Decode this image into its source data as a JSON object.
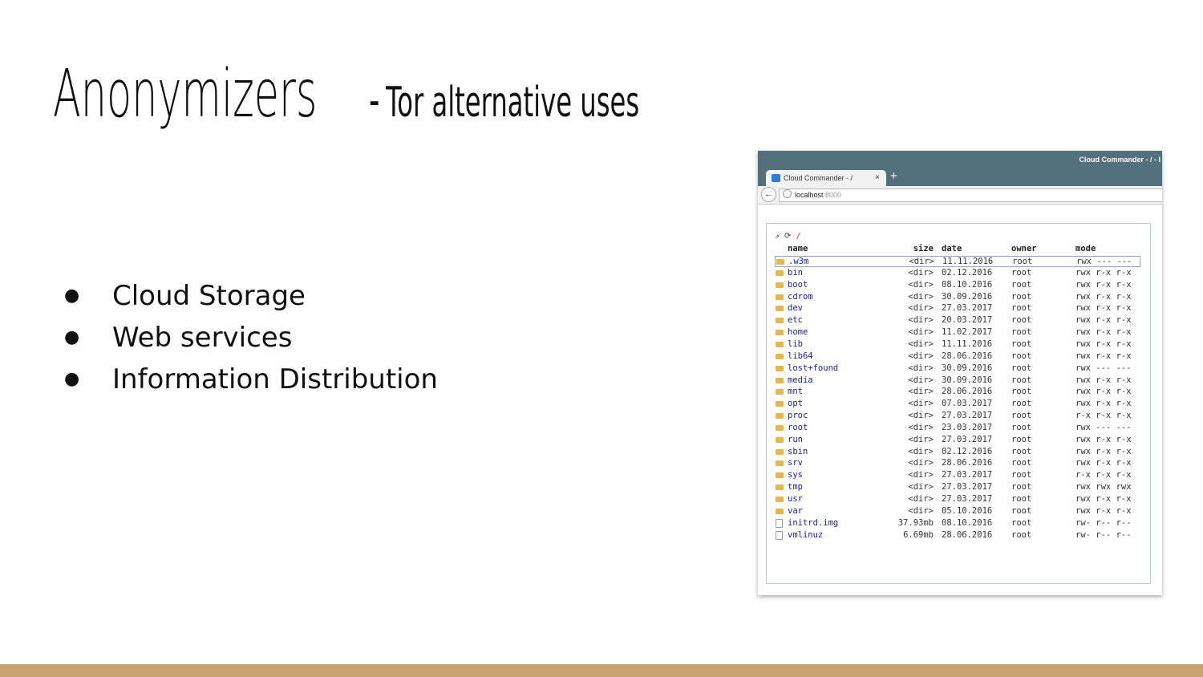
{
  "slide": {
    "title_main": "Anonymizers",
    "title_dash": "-",
    "title_sub": "Tor alternative uses",
    "bullets": [
      "Cloud Storage",
      "Web services",
      "Information Distribution"
    ],
    "bullet_glyph": "●"
  },
  "browser": {
    "window_title": "Cloud Commander - / - I",
    "tab_title": "Cloud Commander - /",
    "tab_close": "×",
    "new_tab": "+",
    "url_host": "localhost",
    "url_port": ":8000"
  },
  "panel": {
    "path_icons": "⇗ ⟳",
    "path": "/",
    "columns": {
      "name": "name",
      "size": "size",
      "date": "date",
      "owner": "owner",
      "mode": "mode"
    },
    "files": [
      {
        "name": ".w3m",
        "size": "<dir>",
        "date": "11.11.2016",
        "owner": "root",
        "mode": "rwx --- ---",
        "type": "folder"
      },
      {
        "name": "bin",
        "size": "<dir>",
        "date": "02.12.2016",
        "owner": "root",
        "mode": "rwx r-x r-x",
        "type": "folder"
      },
      {
        "name": "boot",
        "size": "<dir>",
        "date": "08.10.2016",
        "owner": "root",
        "mode": "rwx r-x r-x",
        "type": "folder"
      },
      {
        "name": "cdrom",
        "size": "<dir>",
        "date": "30.09.2016",
        "owner": "root",
        "mode": "rwx r-x r-x",
        "type": "folder"
      },
      {
        "name": "dev",
        "size": "<dir>",
        "date": "27.03.2017",
        "owner": "root",
        "mode": "rwx r-x r-x",
        "type": "folder"
      },
      {
        "name": "etc",
        "size": "<dir>",
        "date": "20.03.2017",
        "owner": "root",
        "mode": "rwx r-x r-x",
        "type": "folder"
      },
      {
        "name": "home",
        "size": "<dir>",
        "date": "11.02.2017",
        "owner": "root",
        "mode": "rwx r-x r-x",
        "type": "folder"
      },
      {
        "name": "lib",
        "size": "<dir>",
        "date": "11.11.2016",
        "owner": "root",
        "mode": "rwx r-x r-x",
        "type": "folder"
      },
      {
        "name": "lib64",
        "size": "<dir>",
        "date": "28.06.2016",
        "owner": "root",
        "mode": "rwx r-x r-x",
        "type": "folder"
      },
      {
        "name": "lost+found",
        "size": "<dir>",
        "date": "30.09.2016",
        "owner": "root",
        "mode": "rwx --- ---",
        "type": "folder"
      },
      {
        "name": "media",
        "size": "<dir>",
        "date": "30.09.2016",
        "owner": "root",
        "mode": "rwx r-x r-x",
        "type": "folder"
      },
      {
        "name": "mnt",
        "size": "<dir>",
        "date": "28.06.2016",
        "owner": "root",
        "mode": "rwx r-x r-x",
        "type": "folder"
      },
      {
        "name": "opt",
        "size": "<dir>",
        "date": "07.03.2017",
        "owner": "root",
        "mode": "rwx r-x r-x",
        "type": "folder"
      },
      {
        "name": "proc",
        "size": "<dir>",
        "date": "27.03.2017",
        "owner": "root",
        "mode": "r-x r-x r-x",
        "type": "folder"
      },
      {
        "name": "root",
        "size": "<dir>",
        "date": "23.03.2017",
        "owner": "root",
        "mode": "rwx --- ---",
        "type": "folder"
      },
      {
        "name": "run",
        "size": "<dir>",
        "date": "27.03.2017",
        "owner": "root",
        "mode": "rwx r-x r-x",
        "type": "folder"
      },
      {
        "name": "sbin",
        "size": "<dir>",
        "date": "02.12.2016",
        "owner": "root",
        "mode": "rwx r-x r-x",
        "type": "folder"
      },
      {
        "name": "srv",
        "size": "<dir>",
        "date": "28.06.2016",
        "owner": "root",
        "mode": "rwx r-x r-x",
        "type": "folder"
      },
      {
        "name": "sys",
        "size": "<dir>",
        "date": "27.03.2017",
        "owner": "root",
        "mode": "r-x r-x r-x",
        "type": "folder"
      },
      {
        "name": "tmp",
        "size": "<dir>",
        "date": "27.03.2017",
        "owner": "root",
        "mode": "rwx rwx rwx",
        "type": "folder"
      },
      {
        "name": "usr",
        "size": "<dir>",
        "date": "27.03.2017",
        "owner": "root",
        "mode": "rwx r-x r-x",
        "type": "folder"
      },
      {
        "name": "var",
        "size": "<dir>",
        "date": "05.10.2016",
        "owner": "root",
        "mode": "rwx r-x r-x",
        "type": "folder"
      },
      {
        "name": "initrd.img",
        "size": "37.93mb",
        "date": "08.10.2016",
        "owner": "root",
        "mode": "rw- r-- r--",
        "type": "file"
      },
      {
        "name": "vmlinuz",
        "size": "6.69mb",
        "date": "28.06.2016",
        "owner": "root",
        "mode": "rw- r-- r--",
        "type": "file"
      }
    ]
  },
  "colors": {
    "footer": "#c9a472",
    "browser_chrome": "#54707d",
    "link": "#1a1aa8",
    "folder": "#e8b64a"
  }
}
